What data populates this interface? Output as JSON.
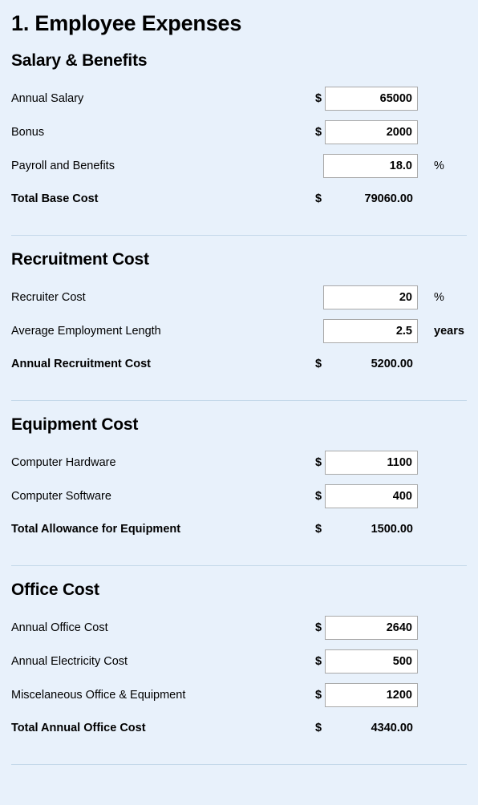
{
  "page": {
    "title": "1. Employee Expenses"
  },
  "colors": {
    "background": "#e8f1fb",
    "divider": "#c5d9ea",
    "field_border": "#a9a9a9",
    "field_background": "#ffffff",
    "text": "#000000"
  },
  "symbols": {
    "currency": "$",
    "percent": "%",
    "years": "years"
  },
  "sections": [
    {
      "id": "salary-and-benefits",
      "title": "Salary & Benefits",
      "rows": [
        {
          "id": "annual-salary",
          "label": "Annual Salary",
          "prefix": "$",
          "value": "65000",
          "suffix": ""
        },
        {
          "id": "bonus",
          "label": "Bonus",
          "prefix": "$",
          "value": "2000",
          "suffix": ""
        },
        {
          "id": "payroll-and-benefits",
          "label": "Payroll and Benefits",
          "prefix": "",
          "value": "18.0",
          "suffix": "%"
        }
      ],
      "total": {
        "id": "total-base-cost",
        "label": "Total Base Cost",
        "prefix": "$",
        "value": "79060.00"
      }
    },
    {
      "id": "recruitment-cost",
      "title": "Recruitment Cost",
      "rows": [
        {
          "id": "recruiter-cost",
          "label": "Recruiter Cost",
          "prefix": "",
          "value": "20",
          "suffix": "%"
        },
        {
          "id": "average-employment-length",
          "label": "Average Employment Length",
          "prefix": "",
          "value": "2.5",
          "suffix": "years"
        }
      ],
      "total": {
        "id": "annual-recruitment-cost",
        "label": "Annual Recruitment Cost",
        "prefix": "$",
        "value": "5200.00"
      }
    },
    {
      "id": "equipment-cost",
      "title": "Equipment Cost",
      "rows": [
        {
          "id": "computer-hardware",
          "label": "Computer Hardware",
          "prefix": "$",
          "value": "1100",
          "suffix": ""
        },
        {
          "id": "computer-software",
          "label": "Computer Software",
          "prefix": "$",
          "value": "400",
          "suffix": ""
        }
      ],
      "total": {
        "id": "total-allowance-for-equipment",
        "label": "Total Allowance for Equipment",
        "prefix": "$",
        "value": "1500.00"
      }
    },
    {
      "id": "office-cost",
      "title": "Office Cost",
      "rows": [
        {
          "id": "annual-office-cost",
          "label": "Annual Office Cost",
          "prefix": "$",
          "value": "2640",
          "suffix": ""
        },
        {
          "id": "annual-electricity-cost",
          "label": "Annual Electricity Cost",
          "prefix": "$",
          "value": "500",
          "suffix": ""
        },
        {
          "id": "miscelaneous-office-and-equipment",
          "label": "Miscelaneous Office & Equipment",
          "prefix": "$",
          "value": "1200",
          "suffix": ""
        }
      ],
      "total": {
        "id": "total-annual-office-cost",
        "label": "Total Annual Office Cost",
        "prefix": "$",
        "value": "4340.00"
      }
    }
  ]
}
